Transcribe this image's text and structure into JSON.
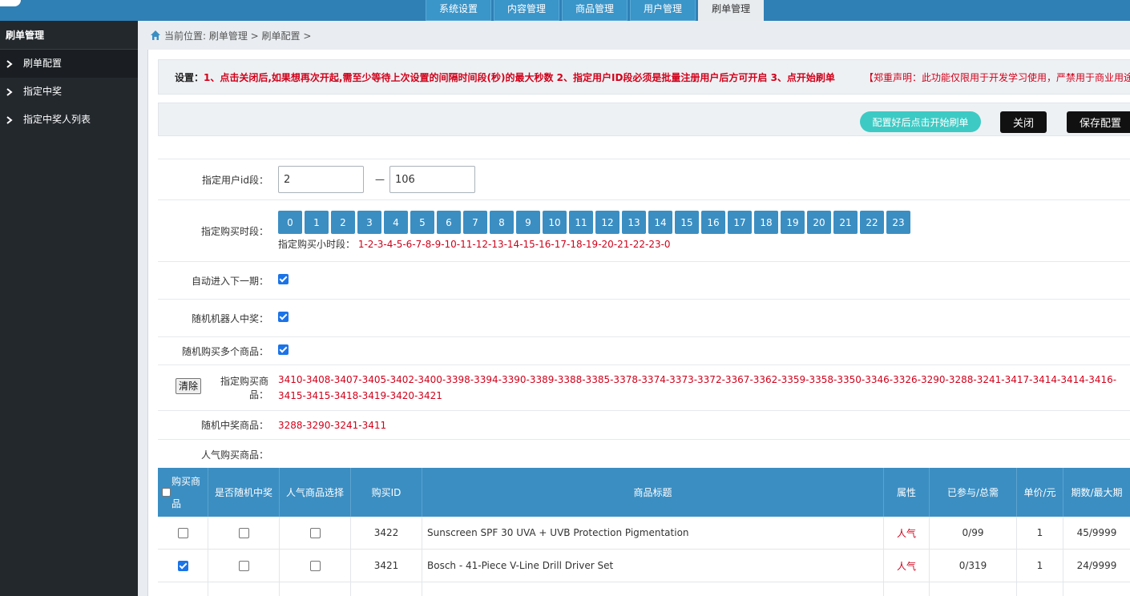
{
  "topnav": {
    "tabs": [
      {
        "label": "系统设置",
        "active": false
      },
      {
        "label": "内容管理",
        "active": false
      },
      {
        "label": "商品管理",
        "active": false
      },
      {
        "label": "用户管理",
        "active": false
      },
      {
        "label": "刷单管理",
        "active": true
      }
    ]
  },
  "sidebar": {
    "title": "刷单管理",
    "items": [
      {
        "label": "刷单配置",
        "active": true
      },
      {
        "label": "指定中奖",
        "active": false
      },
      {
        "label": "指定中奖人列表",
        "active": false
      }
    ]
  },
  "breadcrumb": {
    "text": "当前位置: 刷单管理 > 刷单配置 >"
  },
  "notice": {
    "label": "设置：",
    "text": "1、点击关闭后,如果想再次开起,需至少等待上次设置的间隔时间段(秒)的最大秒数 2、指定用户ID段必须是批量注册用户后方可开启 3、点开始刷单",
    "declaration": "【郑重声明：此功能仅限用于开发学习使用，严禁用于商业用途"
  },
  "actions": {
    "start_label": "配置好后点击开始刷单",
    "close_label": "关闭",
    "save_label": "保存配置"
  },
  "form": {
    "user_range_label": "指定用户id段：",
    "user_from": "2",
    "user_to": "106",
    "dash": "—",
    "hours_label": "指定购买时段：",
    "hours": [
      "0",
      "1",
      "2",
      "3",
      "4",
      "5",
      "6",
      "7",
      "8",
      "9",
      "10",
      "11",
      "12",
      "13",
      "14",
      "15",
      "16",
      "17",
      "18",
      "19",
      "20",
      "21",
      "22",
      "23"
    ],
    "hours_text_label": "指定购买小时段：",
    "hours_text_value": "1-2-3-4-5-6-7-8-9-10-11-12-13-14-15-16-17-18-19-20-21-22-23-0",
    "auto_next_label": "自动进入下一期：",
    "auto_next": true,
    "robot_win_label": "随机机器人中奖：",
    "robot_win": true,
    "multi_buy_label": "随机购买多个商品：",
    "multi_buy": true,
    "clear_label": "清除",
    "products_label": "指定购买商品：",
    "products_value": "3410-3408-3407-3405-3402-3400-3398-3394-3390-3389-3388-3385-3378-3374-3373-3372-3367-3362-3359-3358-3350-3346-3326-3290-3288-3241-3417-3414-3414-3416-3415-3415-3418-3419-3420-3421",
    "random_win_label": "随机中奖商品：",
    "random_win_value": "3288-3290-3241-3411",
    "popular_label": "人气购买商品：",
    "popular_value": ""
  },
  "table": {
    "headers": {
      "buy": "购买商品",
      "random": "是否随机中奖",
      "popular": "人气商品选择",
      "id": "购买ID",
      "title": "商品标题",
      "attr": "属性",
      "joined": "已参与/总需",
      "price": "单价/元",
      "period": "期数/最大期"
    },
    "rows": [
      {
        "buy": false,
        "random": false,
        "popular": false,
        "id": "3422",
        "title": "Sunscreen SPF 30 UVA + UVB Protection Pigmentation",
        "attr": "人气",
        "joined": "0/99",
        "price": "1",
        "period": "45/9999"
      },
      {
        "buy": true,
        "random": false,
        "popular": false,
        "id": "3421",
        "title": "Bosch - 41-Piece V-Line Drill Driver Set",
        "attr": "人气",
        "joined": "0/319",
        "price": "1",
        "period": "24/9999"
      }
    ]
  },
  "colors": {
    "topbar": "#2f80b5",
    "sidebar": "#23282d",
    "accent": "#3b8ec2",
    "teal": "#3dcac4",
    "red": "#d0021b"
  }
}
